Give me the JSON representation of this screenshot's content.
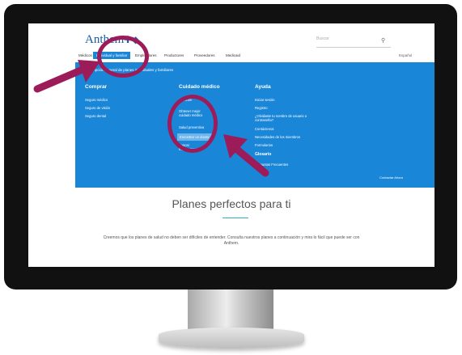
{
  "header": {
    "logo": "Anthem",
    "search_placeholder": "Buscar",
    "language": "Español",
    "nav": [
      "Médicos",
      "Individual y familiar",
      "Empleadores",
      "Productores",
      "Proveedores",
      "Medicaid"
    ]
  },
  "menu": {
    "top_link": "Descripción general de planes individuales y familiares",
    "columns": [
      {
        "title": "Comprar",
        "items": [
          "Seguro médico",
          "Seguro de visión",
          "Seguro dental"
        ]
      },
      {
        "title": "Cuidado médico",
        "items": [
          "Atención",
          "Obtener mejor cuidado médico",
          "Salud preventiva",
          "Encontrar un doctor",
          "Buscar medicamentos"
        ]
      },
      {
        "title": "Ayuda",
        "items": [
          "Iniciar sesión",
          "Registro",
          "¿Olvidaste tu nombre de usuario o contraseña?",
          "Contáctenos",
          "Necesidades de los miembros",
          "Formularios",
          "Glosario",
          "Preguntas Frecuentes"
        ]
      }
    ],
    "contact": "Contactar Ahora"
  },
  "main": {
    "headline": "Planes perfectos para ti",
    "description": "Creemos que los planes de salud no deben ser difíciles de entender. Consulta nuestros planes a continuación y mira lo fácil que puede ser con Anthem."
  },
  "colors": {
    "accent_blue": "#1a86d8",
    "annotation": "#9c1c5a",
    "teal": "#2ab2b8"
  }
}
